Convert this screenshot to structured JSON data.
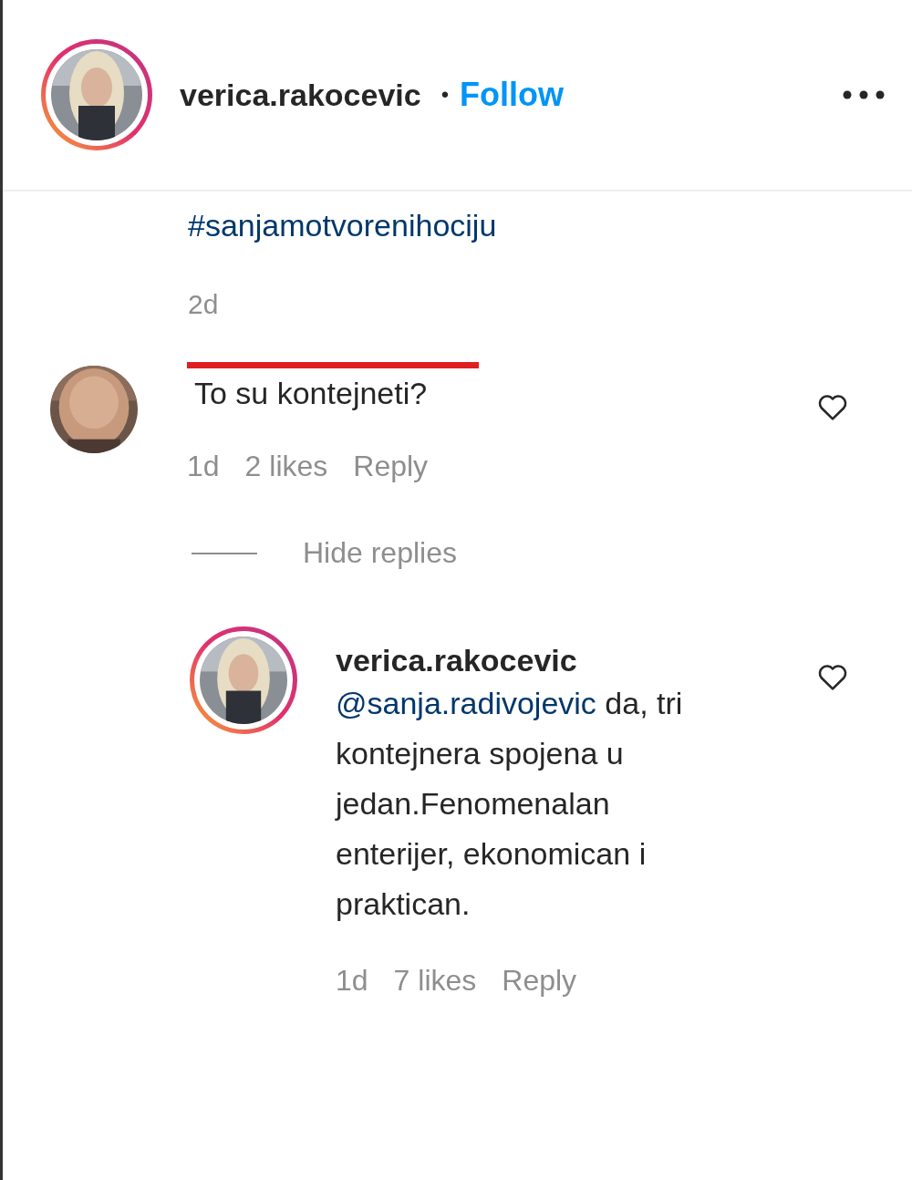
{
  "header": {
    "username": "verica.rakocevic",
    "story_ring": true,
    "separator": "•",
    "follow_label": "Follow"
  },
  "caption": {
    "hashtag": "#sanjamotvorenihociju",
    "time": "2d"
  },
  "comments": [
    {
      "redacted": true,
      "story_ring": false,
      "text": "To su kontejneti?",
      "liked": false,
      "time": "1d",
      "likes": "2 likes",
      "reply_label": "Reply",
      "replies_toggle": "Hide replies",
      "replies": [
        {
          "username": "verica.rakocevic",
          "redacted": false,
          "story_ring": true,
          "mention": "@sanja.radivojevic",
          "text": " da, tri kontejnera spojena u jedan.Fenomenalan enterijer, ekonomican i praktican.",
          "liked": false,
          "time": "1d",
          "likes": "7 likes",
          "reply_label": "Reply"
        }
      ]
    }
  ]
}
